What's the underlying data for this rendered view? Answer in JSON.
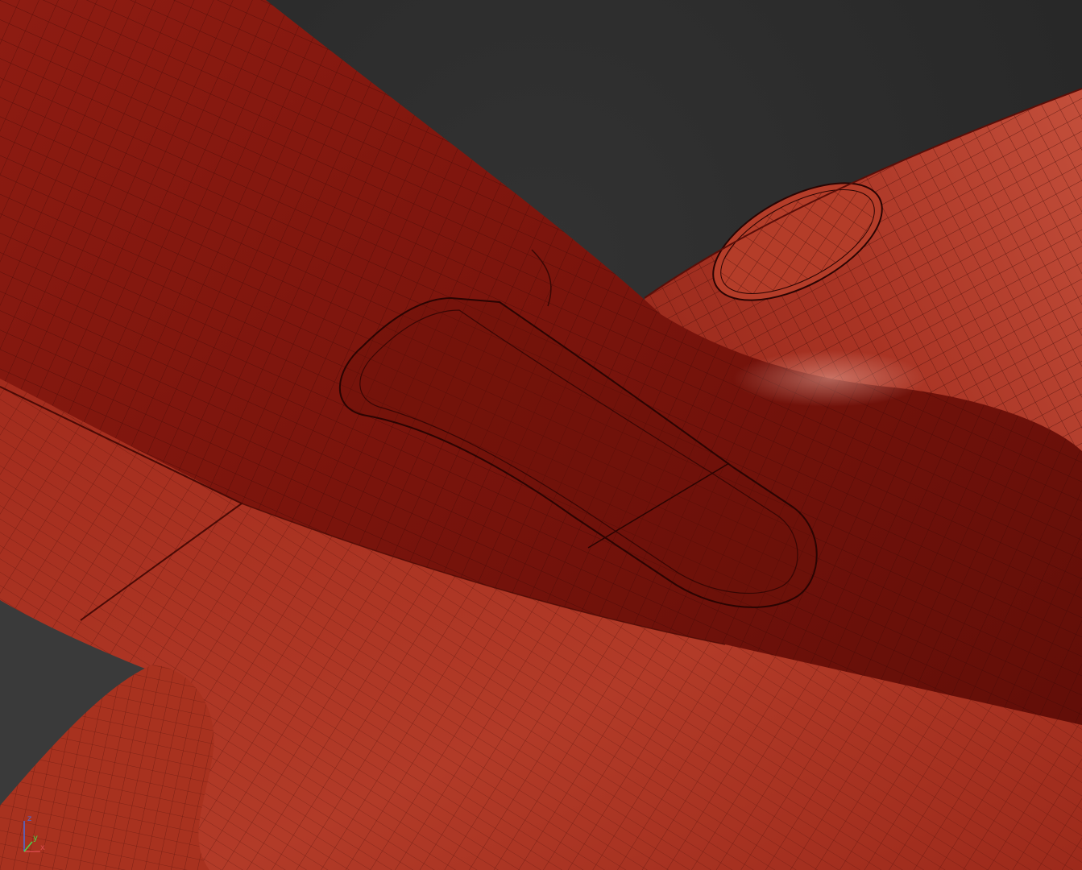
{
  "viewport": {
    "background": "#2b2b2b",
    "mesh_color": "#9a2418",
    "mesh_highlight": "#c9533f",
    "mesh_shadow": "#5a0e08",
    "wire_color": "#3a0704"
  },
  "gizmo": {
    "axes": [
      {
        "name": "z",
        "label": "z",
        "color": "#4a6bd8"
      },
      {
        "name": "x",
        "label": "x",
        "color": "#d84a4a"
      },
      {
        "name": "y",
        "label": "y",
        "color": "#4ad84a"
      }
    ]
  }
}
